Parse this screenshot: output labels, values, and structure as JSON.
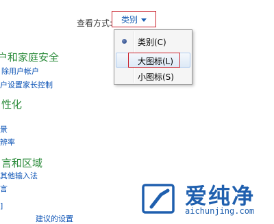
{
  "viewby": {
    "label": "查看方式:",
    "selected": "类别"
  },
  "menu": {
    "items": [
      {
        "label": "类别(C)",
        "checked": true
      },
      {
        "label": "大图标(L)",
        "checked": false
      },
      {
        "label": "小图标(S)",
        "checked": false
      }
    ]
  },
  "left": {
    "section1": "户和家庭安全",
    "section1_links": [
      "除用户帐户",
      "户设置家长控制"
    ],
    "section2": "性化",
    "section2_links": [
      "景",
      "辨率"
    ],
    "section3": "言和区域",
    "section3_links": [
      "其他输入法",
      "言"
    ],
    "section4_partial": "]",
    "bottom_partial": "建议的设置"
  },
  "watermark": {
    "text": "爱纯净",
    "url": "aichunjing.com"
  },
  "colors": {
    "highlight_border": "#c9202b",
    "link": "#0a52b5",
    "category": "#2d8c3c"
  }
}
